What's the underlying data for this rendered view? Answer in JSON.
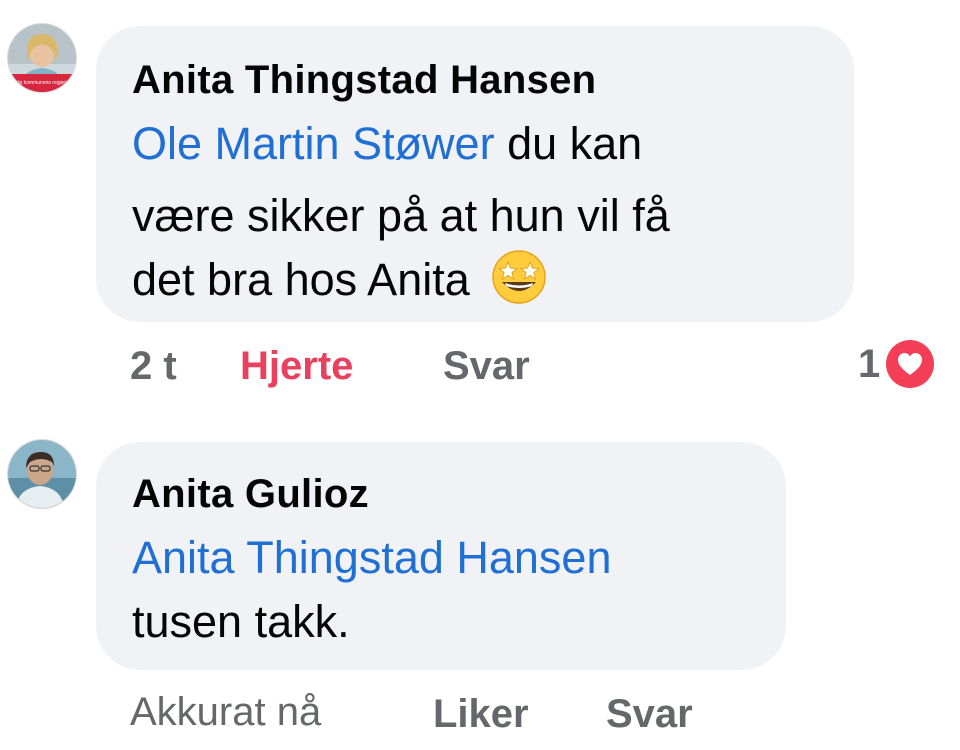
{
  "comments": [
    {
      "author": "Anita Thingstad Hansen",
      "avatar_caption": "Følg kommunens regjering",
      "mention": "Ole Martin Støwer",
      "text_line1_rest": " du kan",
      "text_line2": "være sikker på at hun vil få",
      "text_line3": "det bra hos Anita",
      "emoji": "star-struck-emoji",
      "time": "2 t",
      "reaction_action": "Hjerte",
      "reply_action": "Svar",
      "reaction_count": "1",
      "reaction_icon": "heart-icon"
    },
    {
      "author": "Anita Gulioz",
      "mention": "Anita Thingstad Hansen",
      "text_line2": "tusen takk.",
      "time": "Akkurat nå",
      "like_action": "Liker",
      "reply_action": "Svar"
    }
  ],
  "colors": {
    "bubble": "#f0f2f5",
    "mention": "#1f6fd4",
    "heart": "#e8405e",
    "muted": "#65676b"
  }
}
